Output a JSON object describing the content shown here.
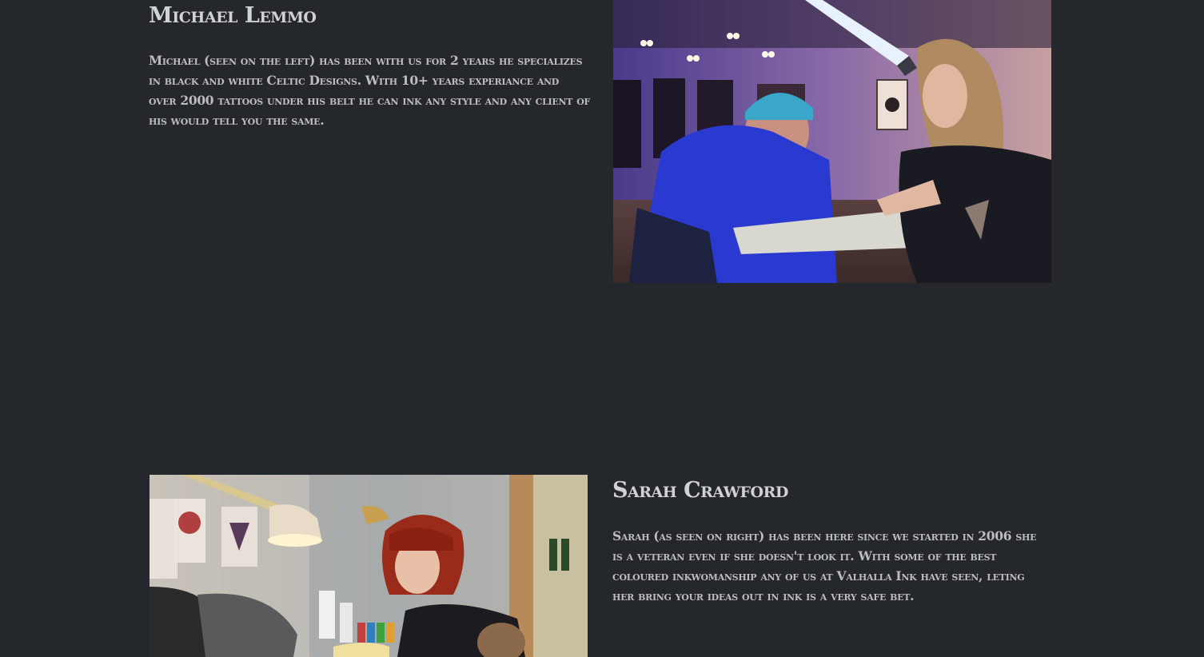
{
  "artists": [
    {
      "name": "Michael Lemmo",
      "bio": "Michael (seen on the left) has been with us for 2 years he specializes in black and white Celtic Designs. With 10+ years experiance and over 2000 tattoos under his belt he can ink any style and any client of his would tell you the same.",
      "photo_icon": "tattoo-session-photo"
    },
    {
      "name": "Sarah Crawford",
      "bio": "Sarah (as seen on right) has been here since we started in 2006 she is a veteran even if she doesn't look it. With some of the best coloured inkwomanship any of us at Valhalla Ink have seen, leting her bring your ideas out in ink is a very safe bet.",
      "photo_icon": "tattoo-artist-photo"
    }
  ],
  "colors": {
    "background": "#24282c",
    "heading": "#d2d2d2",
    "body_text": "#bdbdbd"
  }
}
